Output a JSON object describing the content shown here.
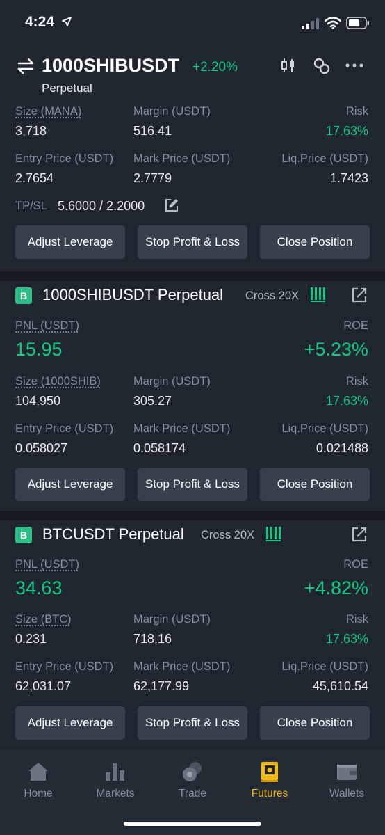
{
  "status_bar": {
    "time": "4:24"
  },
  "header": {
    "symbol": "1000SHIBUSDT",
    "change": "+2.20%",
    "subtitle": "Perpetual"
  },
  "position1": {
    "size_label": "Size (MANA)",
    "size_value": "3,718",
    "margin_label": "Margin (USDT)",
    "margin_value": "516.41",
    "risk_label": "Risk",
    "risk_value": "17.63%",
    "entry_label": "Entry Price (USDT)",
    "entry_value": "2.7654",
    "mark_label": "Mark Price (USDT)",
    "mark_value": "2.7779",
    "liq_label": "Liq.Price (USDT)",
    "liq_value": "1.7423",
    "tpsl_label": "TP/SL",
    "tpsl_value": "5.6000 / 2.2000"
  },
  "position2": {
    "badge": "B",
    "title": "1000SHIBUSDT Perpetual",
    "cross": "Cross 20X",
    "pnl_label": "PNL (USDT)",
    "pnl_value": "15.95",
    "roe_label": "ROE",
    "roe_value": "+5.23%",
    "size_label": "Size (1000SHIB)",
    "size_value": "104,950",
    "margin_label": "Margin (USDT)",
    "margin_value": "305.27",
    "risk_label": "Risk",
    "risk_value": "17.63%",
    "entry_label": "Entry Price (USDT)",
    "entry_value": "0.058027",
    "mark_label": "Mark Price (USDT)",
    "mark_value": "0.058174",
    "liq_label": "Liq.Price (USDT)",
    "liq_value": "0.021488"
  },
  "position3": {
    "badge": "B",
    "title": "BTCUSDT Perpetual",
    "cross": "Cross 20X",
    "pnl_label": "PNL (USDT)",
    "pnl_value": "34.63",
    "roe_label": "ROE",
    "roe_value": "+4.82%",
    "size_label": "Size (BTC)",
    "size_value": "0.231",
    "margin_label": "Margin (USDT)",
    "margin_value": "718.16",
    "risk_label": "Risk",
    "risk_value": "17.63%",
    "entry_label": "Entry Price (USDT)",
    "entry_value": "62,031.07",
    "mark_label": "Mark Price (USDT)",
    "mark_value": "62,177.99",
    "liq_label": "Liq.Price (USDT)",
    "liq_value": "45,610.54"
  },
  "buttons": {
    "adjust_leverage": "Adjust Leverage",
    "stop_profit_loss": "Stop Profit & Loss",
    "close_position": "Close Position"
  },
  "nav": [
    {
      "label": "Home",
      "icon": "home-icon",
      "active": false
    },
    {
      "label": "Markets",
      "icon": "markets-icon",
      "active": false
    },
    {
      "label": "Trade",
      "icon": "trade-icon",
      "active": false
    },
    {
      "label": "Futures",
      "icon": "futures-icon",
      "active": true
    },
    {
      "label": "Wallets",
      "icon": "wallet-icon",
      "active": false
    }
  ],
  "colors": {
    "background": "#1f2630",
    "positive": "#0ecb81",
    "accent": "#f0b90b",
    "button": "#37404d",
    "muted": "#848e9c"
  }
}
